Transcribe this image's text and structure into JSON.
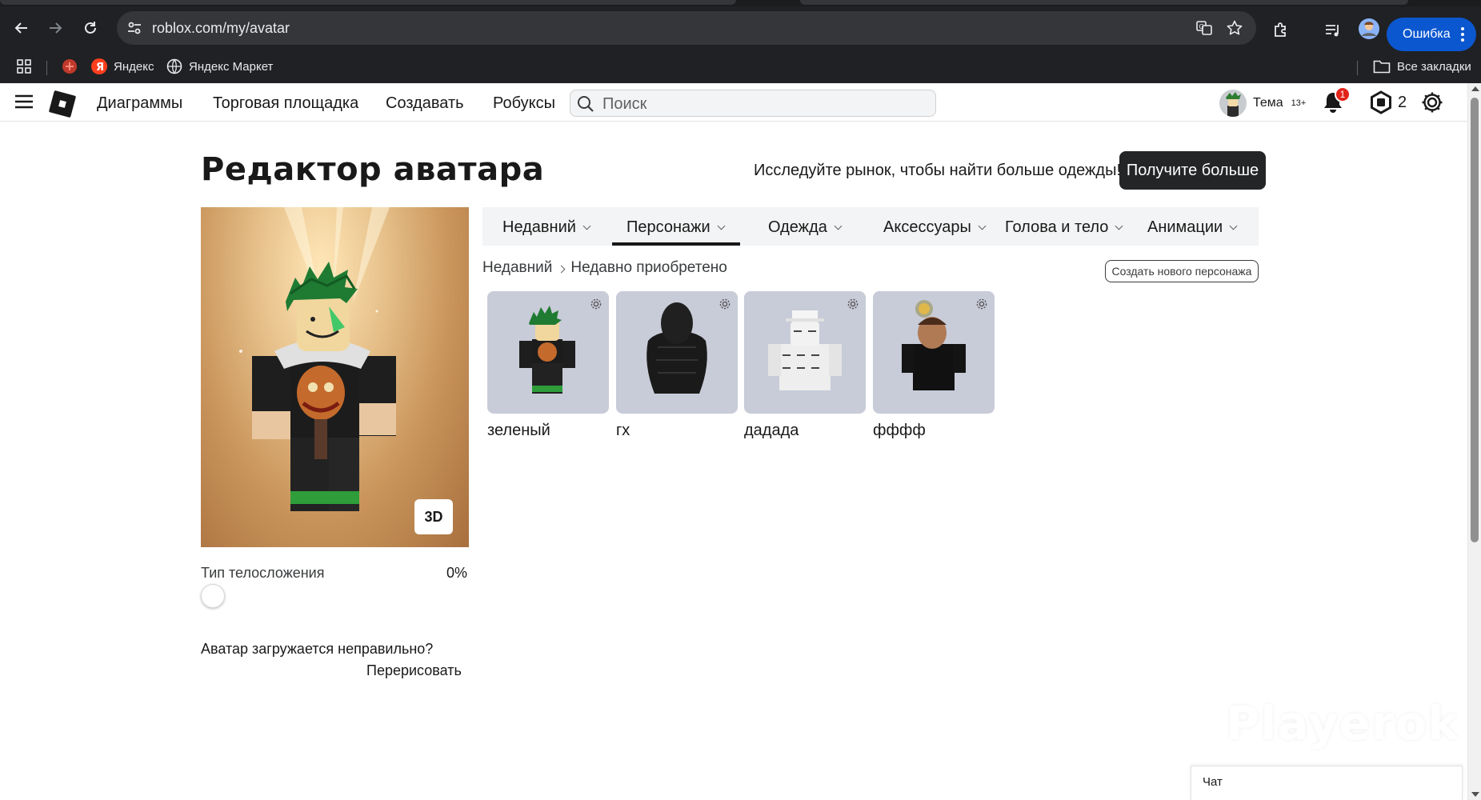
{
  "browser": {
    "url": "roblox.com/my/avatar",
    "error_button_label": "Ошибка",
    "bookmarks": [
      {
        "label": "Яндекс",
        "icon": "yandex-icon"
      },
      {
        "label": "Яндекс Маркет",
        "icon": "globe-icon"
      }
    ],
    "all_bookmarks_label": "Все закладки"
  },
  "topnav": {
    "links": [
      "Диаграммы",
      "Торговая площадка",
      "Создавать",
      "Робуксы"
    ],
    "search_placeholder": "Поиск",
    "user_name": "Тема",
    "age_tag": "13+",
    "notification_count": "1",
    "robux_amount": "2"
  },
  "page": {
    "title": "Редактор аватара",
    "explore_text": "Исследуйте рынок, чтобы найти больше одежды!",
    "get_more_label": "Получите больше",
    "view_3d_label": "3D",
    "body_type_label": "Тип телосложения",
    "body_type_value": "0%",
    "body_type_fraction": 0,
    "redraw_question": "Аватар загружается неправильно?",
    "redraw_link": "Перерисовать"
  },
  "tabs": [
    {
      "label": "Недавний",
      "active": false
    },
    {
      "label": "Персонажи",
      "active": true
    },
    {
      "label": "Одежда",
      "active": false
    },
    {
      "label": "Аксессуары",
      "active": false
    },
    {
      "label": "Голова и тело",
      "active": false
    },
    {
      "label": "Анимации",
      "active": false
    }
  ],
  "breadcrumb": {
    "parent": "Недавний",
    "current": "Недавно приобретено"
  },
  "create_character_label": "Создать нового персонажа",
  "characters": [
    {
      "name": "зеленый"
    },
    {
      "name": "гх"
    },
    {
      "name": "дадада"
    },
    {
      "name": "фффф"
    }
  ],
  "watermark": "Playerok",
  "chat_label": "Чат",
  "colors": {
    "browser_bg": "#202124",
    "error_button": "#0b57d0",
    "primary_button": "#232527",
    "card_bg": "#c8cbd8",
    "notification_badge": "#e2231a"
  }
}
